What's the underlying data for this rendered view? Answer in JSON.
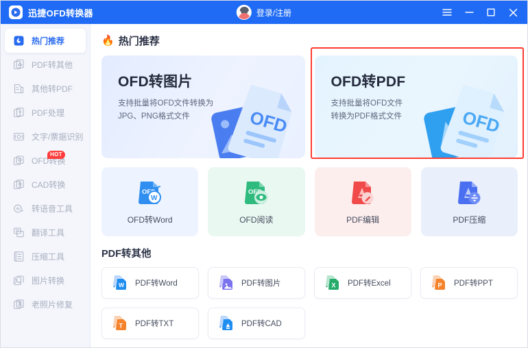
{
  "window": {
    "app_title": "迅捷OFD转换器",
    "logo_icon": "app-logo-icon",
    "account_label": "登录/注册",
    "menu_icon": "hamburger-menu-icon",
    "minimize_icon": "minimize-icon",
    "maximize_icon": "maximize-icon",
    "close_icon": "close-icon",
    "titlebar_color": "#1f6bf5"
  },
  "sidebar": {
    "items": [
      {
        "label": "热门推荐",
        "icon": "fire-recommend-icon",
        "active": true,
        "badge": ""
      },
      {
        "label": "PDF转其他",
        "icon": "pdf-to-other-icon",
        "active": false,
        "badge": ""
      },
      {
        "label": "其他转PDF",
        "icon": "other-to-pdf-icon",
        "active": false,
        "badge": ""
      },
      {
        "label": "PDF处理",
        "icon": "pdf-process-icon",
        "active": false,
        "badge": ""
      },
      {
        "label": "文字/票据识别",
        "icon": "ocr-recognize-icon",
        "active": false,
        "badge": ""
      },
      {
        "label": "OFD转换",
        "icon": "ofd-convert-icon",
        "active": false,
        "badge": "HOT"
      },
      {
        "label": "CAD转换",
        "icon": "cad-convert-icon",
        "active": false,
        "badge": ""
      },
      {
        "label": "转语音工具",
        "icon": "text-to-speech-icon",
        "active": false,
        "badge": ""
      },
      {
        "label": "翻译工具",
        "icon": "translate-icon",
        "active": false,
        "badge": ""
      },
      {
        "label": "压缩工具",
        "icon": "compress-icon",
        "active": false,
        "badge": ""
      },
      {
        "label": "图片转换",
        "icon": "image-convert-icon",
        "active": false,
        "badge": ""
      },
      {
        "label": "老照片修复",
        "icon": "photo-restore-icon",
        "active": false,
        "badge": ""
      }
    ]
  },
  "main": {
    "hot_section": {
      "flame_icon": "flame-icon",
      "title": "热门推荐",
      "hero_cards": [
        {
          "title": "OFD转图片",
          "desc_line1": "支持批量将OFD文件转换为",
          "desc_line2": "JPG、PNG格式文件",
          "selected": false,
          "art_icon": "ofd-to-image-art"
        },
        {
          "title": "OFD转PDF",
          "desc_line1": "支持批量将OFD文件",
          "desc_line2": "转换为PDF格式文件",
          "selected": true,
          "art_icon": "ofd-to-pdf-art"
        }
      ],
      "selection_border_color": "#ff3b30",
      "tiles": [
        {
          "label": "OFD转Word",
          "icon": "ofd-to-word-icon",
          "tone": "t-blue"
        },
        {
          "label": "OFD阅读",
          "icon": "ofd-reader-icon",
          "tone": "t-green"
        },
        {
          "label": "PDF编辑",
          "icon": "pdf-edit-icon",
          "tone": "t-red"
        },
        {
          "label": "PDF压缩",
          "icon": "pdf-compress-icon",
          "tone": "t-indigo"
        }
      ]
    },
    "convert_section": {
      "title": "PDF转其他",
      "cards": [
        {
          "label": "PDF转Word",
          "icon": "pdf-to-word-icon"
        },
        {
          "label": "PDF转图片",
          "icon": "pdf-to-image-icon"
        },
        {
          "label": "PDF转Excel",
          "icon": "pdf-to-excel-icon"
        },
        {
          "label": "PDF转PPT",
          "icon": "pdf-to-ppt-icon"
        },
        {
          "label": "PDF转TXT",
          "icon": "pdf-to-txt-icon"
        },
        {
          "label": "PDF转CAD",
          "icon": "pdf-to-cad-icon"
        }
      ]
    }
  }
}
